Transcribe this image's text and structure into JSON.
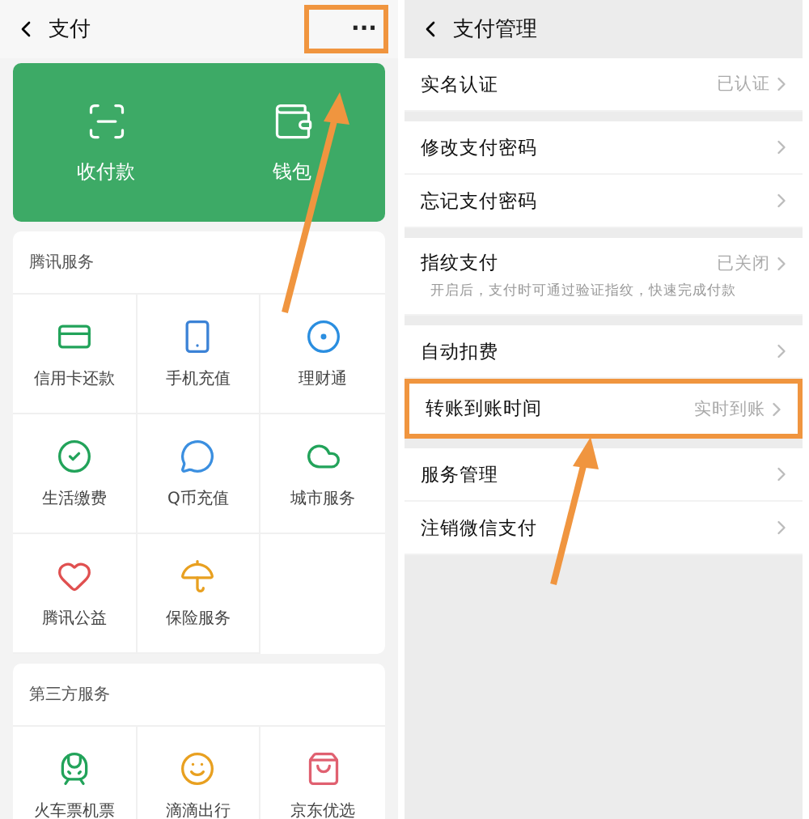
{
  "left": {
    "title": "支付",
    "more": {
      "label": "···",
      "highlighted": true
    },
    "top_card": [
      {
        "label": "收付款"
      },
      {
        "label": "钱包"
      }
    ],
    "sections": [
      {
        "title": "腾讯服务",
        "items": [
          {
            "label": "信用卡还款"
          },
          {
            "label": "手机充值"
          },
          {
            "label": "理财通"
          },
          {
            "label": "生活缴费"
          },
          {
            "label": "Q币充值"
          },
          {
            "label": "城市服务"
          },
          {
            "label": "腾讯公益"
          },
          {
            "label": "保险服务"
          }
        ]
      },
      {
        "title": "第三方服务",
        "items": [
          {
            "label": "火车票机票"
          },
          {
            "label": "滴滴出行"
          },
          {
            "label": "京东优选"
          }
        ]
      }
    ]
  },
  "right": {
    "title": "支付管理",
    "groups": [
      [
        {
          "label": "实名认证",
          "value": "已认证",
          "highlighted": false
        }
      ],
      [
        {
          "label": "修改支付密码",
          "highlighted": false
        },
        {
          "label": "忘记支付密码",
          "highlighted": false
        }
      ],
      [
        {
          "label": "指纹支付",
          "value": "已关闭",
          "note": "开启后，支付时可通过验证指纹，快速完成付款",
          "highlighted": false
        }
      ],
      [
        {
          "label": "自动扣费",
          "highlighted": false
        },
        {
          "label": "转账到账时间",
          "value": "实时到账",
          "highlighted": true
        }
      ],
      [
        {
          "label": "服务管理",
          "highlighted": false
        },
        {
          "label": "注销微信支付",
          "highlighted": false
        }
      ]
    ]
  }
}
